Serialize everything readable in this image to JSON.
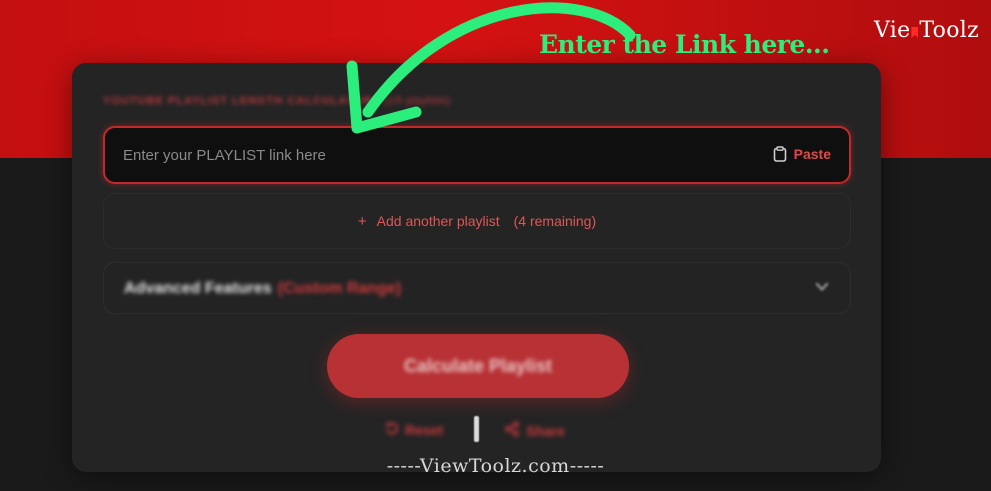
{
  "brand": {
    "logo_text_left": "Vie",
    "logo_text_right": "Toolz"
  },
  "annotation": {
    "text": "Enter the Link here...",
    "color": "#2bee7d"
  },
  "card": {
    "title": "YOUTUBE PLAYLIST LENGTH CALCULATOR",
    "subtitle": "(1/5 playlists)",
    "input": {
      "value": "",
      "placeholder": "Enter your PLAYLIST link here"
    },
    "paste_label": "Paste",
    "add_playlist": {
      "plus": "+",
      "label": "Add another playlist",
      "remaining": "(4 remaining)"
    },
    "advanced": {
      "label": "Advanced Features",
      "range": "(Custom Range)",
      "icon": "chevron-down-icon"
    },
    "calculate_label": "Calculate Playlist",
    "reset_label": "Reset",
    "share_label": "Share"
  },
  "footer": {
    "watermark": "-----ViewToolz.com-----"
  },
  "colors": {
    "accent": "#c3282a",
    "band": "#c40f10",
    "background": "#1a1a1b",
    "card": "#242425"
  }
}
